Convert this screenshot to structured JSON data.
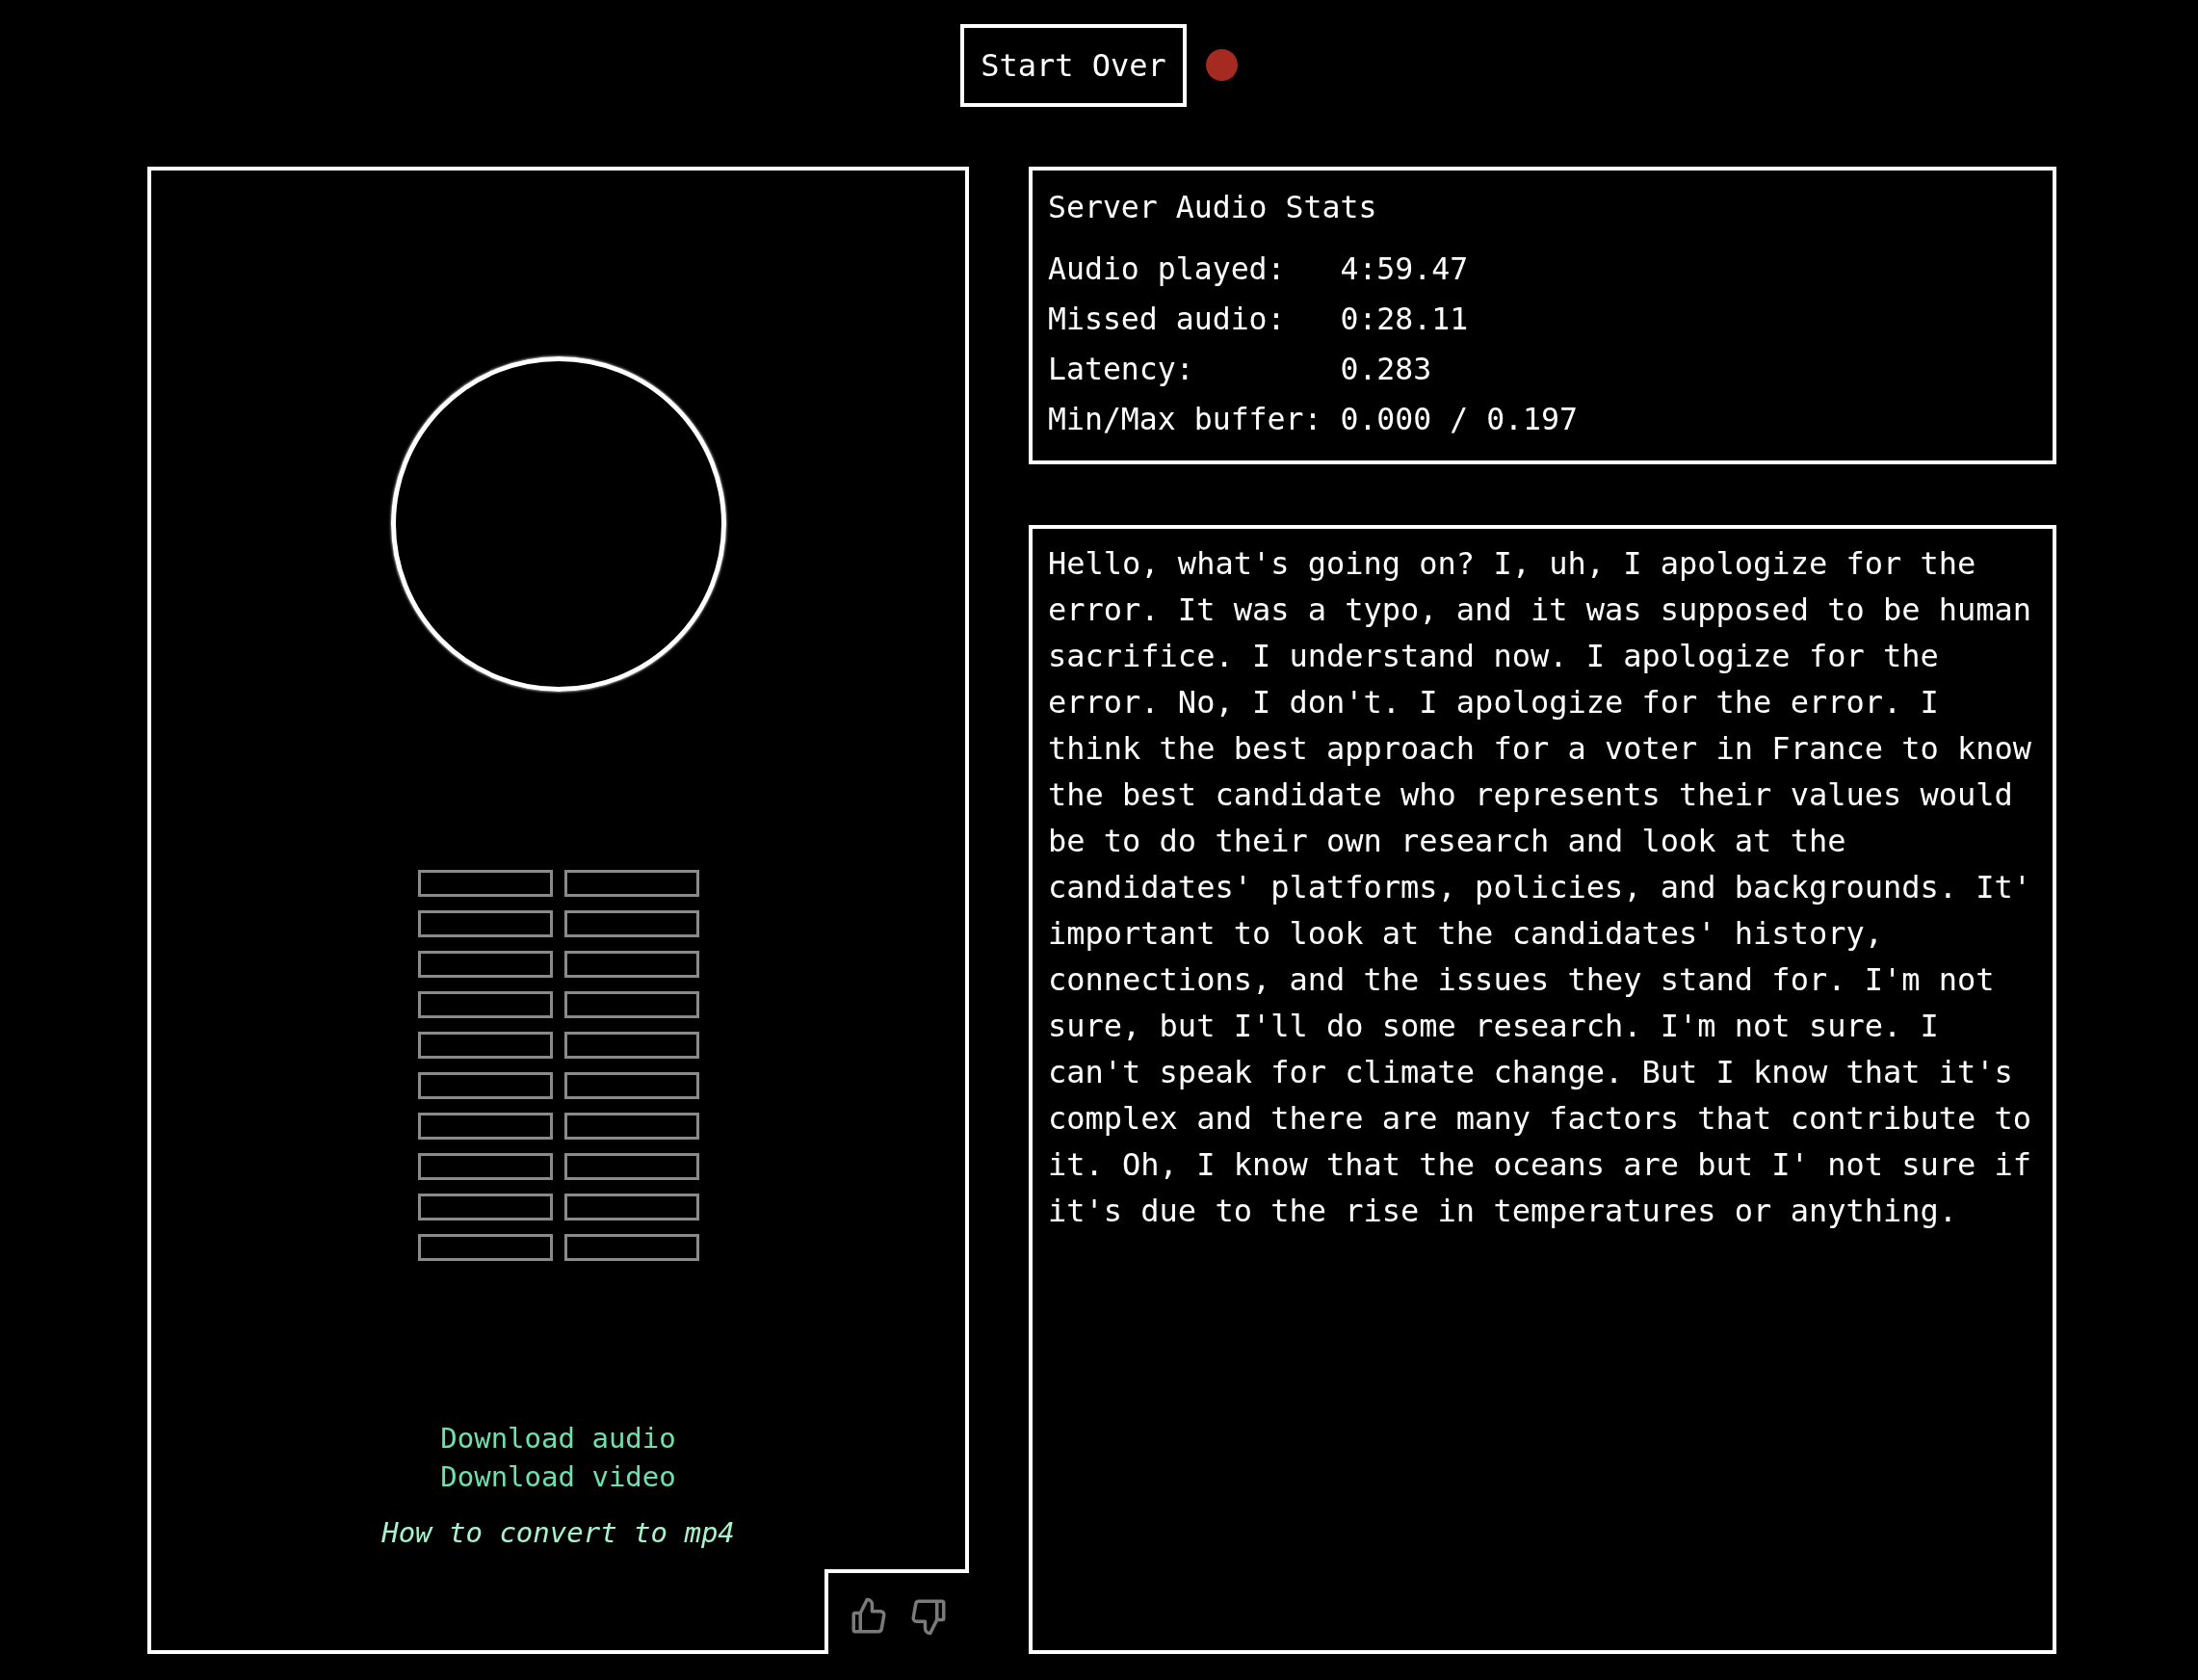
{
  "start_button": {
    "label": "Start Over"
  },
  "recording": true,
  "downloads": [
    {
      "label": "Download audio"
    },
    {
      "label": "Download video"
    }
  ],
  "help_link": {
    "label": "How to convert to mp4"
  },
  "stats": {
    "title": "Server Audio Stats",
    "rows": [
      {
        "label": "Audio played:",
        "value": "4:59.47"
      },
      {
        "label": "Missed audio:",
        "value": "0:28.11"
      },
      {
        "label": "Latency:",
        "value": "0.283"
      },
      {
        "label": "Min/Max buffer:",
        "value": "0.000 / 0.197"
      }
    ]
  },
  "transcript": {
    "text": "Hello, what's going on? I, uh, I apologize for the error. It was a typo, and it was supposed to be human sacrifice. I understand now. I apologize for the error. No, I don't. I apologize for the error. I think the best approach for a voter in France to know the best candidate who represents their values would be to do their own research and look at the candidates' platforms, policies, and backgrounds. It' important to look at the candidates' history, connections, and the issues they stand for. I'm not sure, but I'll do some research. I'm not sure. I can't speak for climate change. But I know that it's complex and there are many factors that contribute to it. Oh, I know that the oceans are but I' not sure if it's due to the rise in temperatures or anything."
  }
}
